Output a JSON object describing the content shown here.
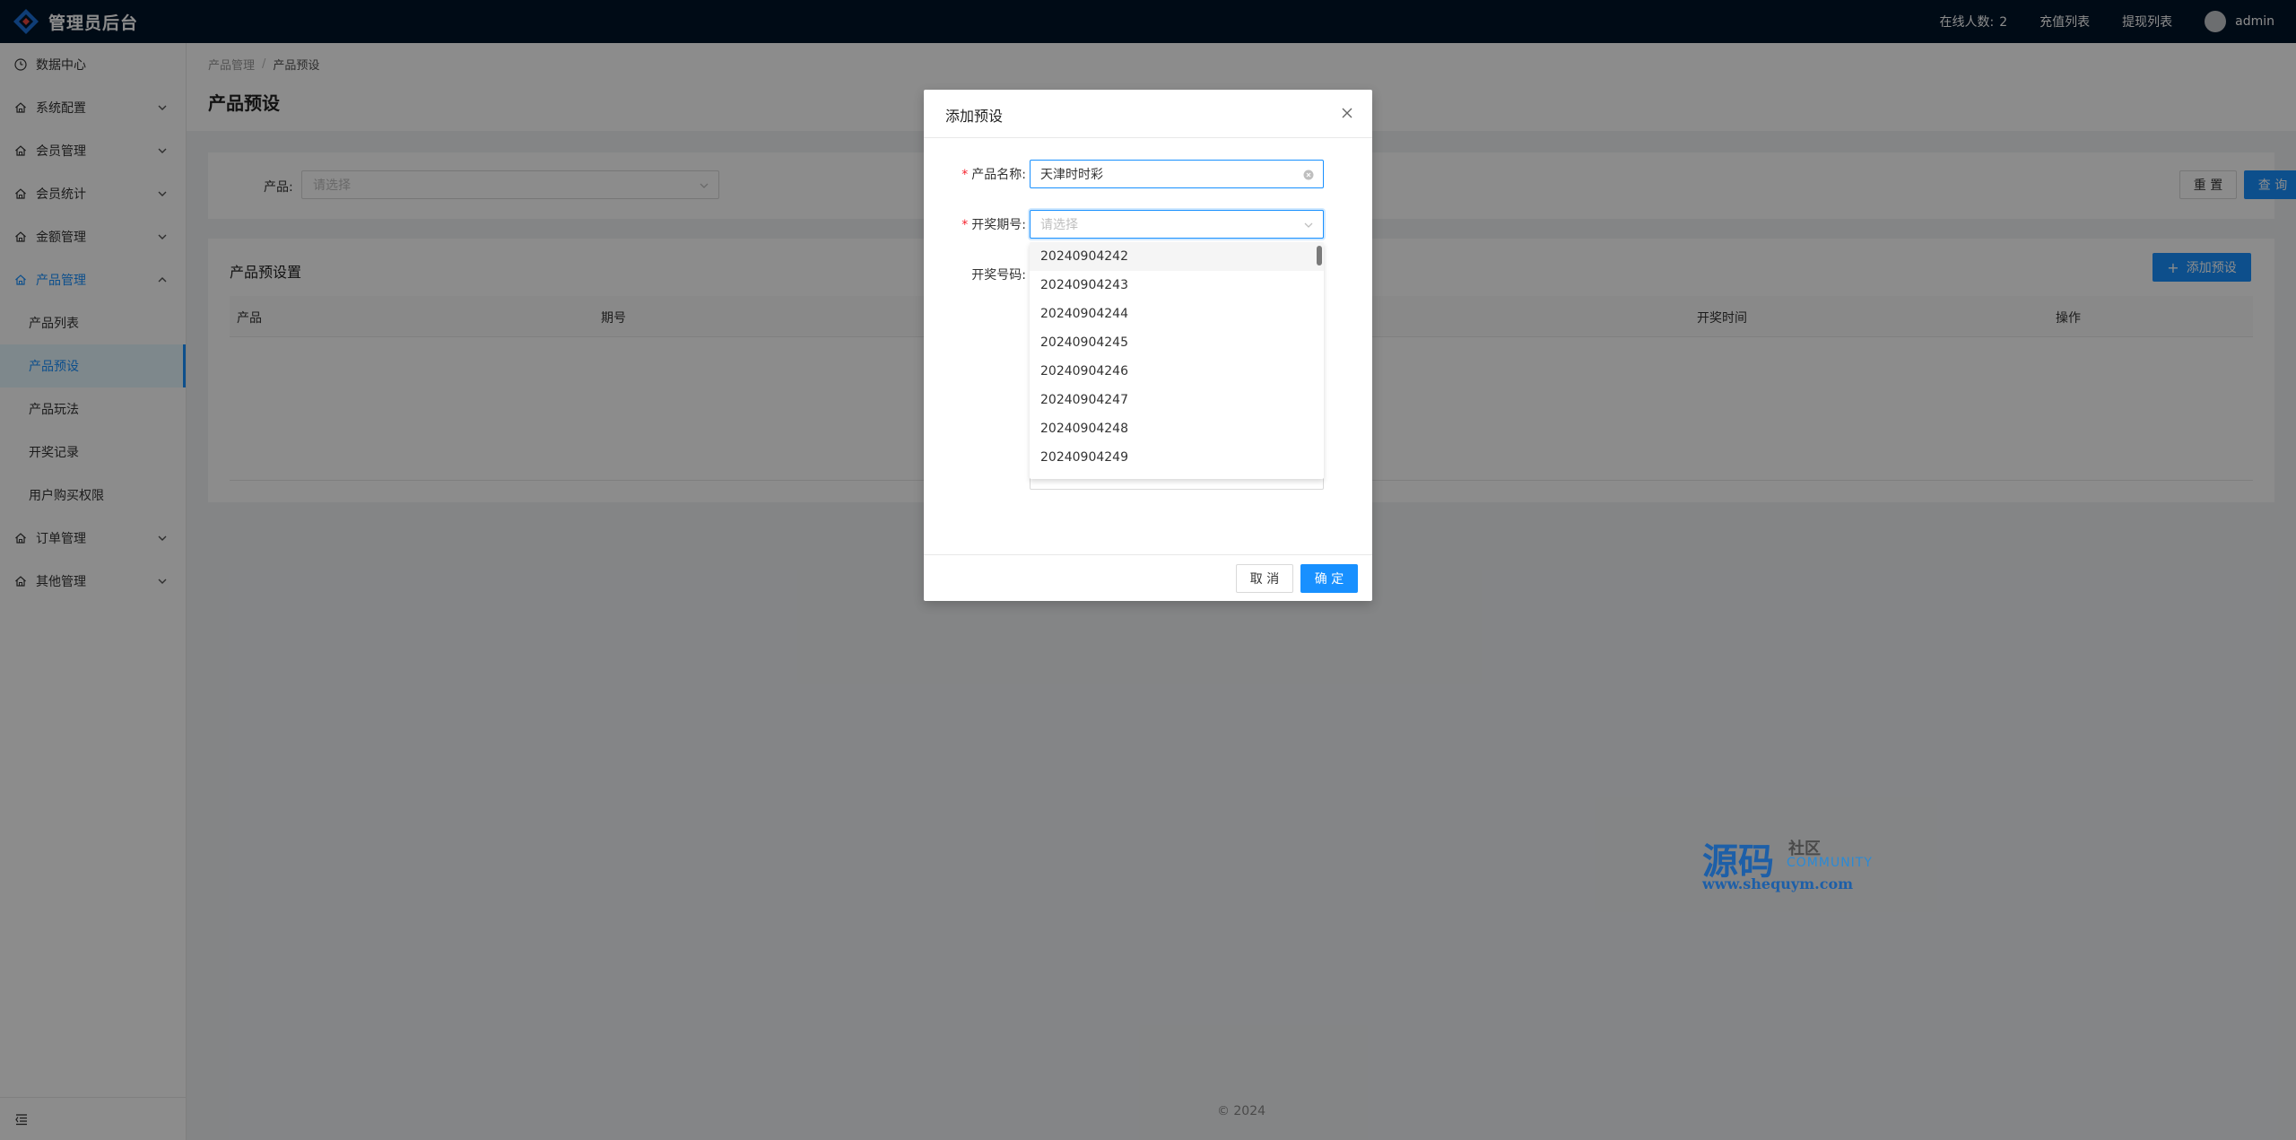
{
  "header": {
    "title": "管理员后台",
    "online_label": "在线人数:",
    "online_count": "2",
    "recharge_link": "充值列表",
    "withdraw_link": "提现列表",
    "user": "admin"
  },
  "sidebar": {
    "items": [
      {
        "label": "数据中心",
        "icon": "dashboard-icon"
      },
      {
        "label": "系统配置",
        "icon": "home-icon"
      },
      {
        "label": "会员管理",
        "icon": "home-icon"
      },
      {
        "label": "会员统计",
        "icon": "home-icon"
      },
      {
        "label": "金额管理",
        "icon": "home-icon"
      },
      {
        "label": "产品管理",
        "icon": "home-icon",
        "open": true
      },
      {
        "label": "订单管理",
        "icon": "home-icon"
      },
      {
        "label": "其他管理",
        "icon": "home-icon"
      }
    ],
    "sub_items": [
      "产品列表",
      "产品预设",
      "产品玩法",
      "开奖记录",
      "用户购买权限"
    ]
  },
  "breadcrumb": {
    "parent": "产品管理",
    "current": "产品预设"
  },
  "page_title": "产品预设",
  "filter": {
    "label": "产品:",
    "placeholder": "请选择",
    "reset_label": "重 置",
    "query_label": "查 询"
  },
  "table_card": {
    "title": "产品预设置",
    "add_label": "添加预设",
    "columns": [
      "产品",
      "期号",
      "开奖时间",
      "操作"
    ]
  },
  "footer": "© 2024",
  "modal": {
    "title": "添加预设",
    "product_label": "产品名称:",
    "product_value": "天津时时彩",
    "issue_label": "开奖期号:",
    "issue_placeholder": "请选择",
    "number_label": "开奖号码:",
    "cancel_label": "取 消",
    "ok_label": "确 定",
    "options": [
      "20240904242",
      "20240904243",
      "20240904244",
      "20240904245",
      "20240904246",
      "20240904247",
      "20240904248",
      "20240904249"
    ]
  },
  "watermark": {
    "main": "源码",
    "side": "社区",
    "community": "COMMUNITY",
    "url": "www.shequym.com"
  },
  "colors": {
    "accent": "#1890ff",
    "header_bg": "#001529",
    "required": "#f5222d"
  }
}
